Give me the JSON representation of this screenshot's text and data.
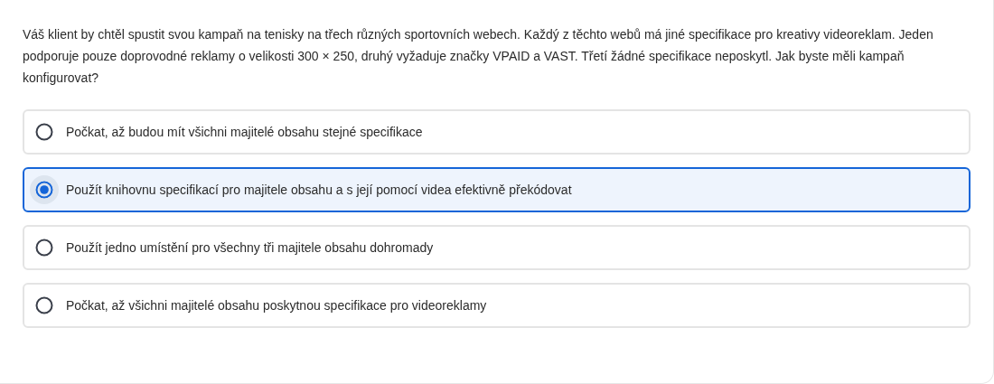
{
  "question": "Váš klient by chtěl spustit svou kampaň na tenisky na třech různých sportovních webech. Každý z těchto webů má jiné specifikace pro kreativy videoreklam. Jeden podporuje pouze doprovodné reklamy o velikosti 300 × 250, druhý vyžaduje značky VPAID a VAST. Třetí žádné specifikace neposkytl. Jak byste měli kampaň konfigurovat?",
  "options": [
    {
      "label": "Počkat, až budou mít všichni majitelé obsahu stejné specifikace",
      "selected": false
    },
    {
      "label": "Použít knihovnu specifikací pro majitele obsahu a s její pomocí videa efektivně překódovat",
      "selected": true
    },
    {
      "label": "Použít jedno umístění pro všechny tři majitele obsahu dohromady",
      "selected": false
    },
    {
      "label": "Počkat, až všichni majitelé obsahu poskytnou specifikace pro videoreklamy",
      "selected": false
    }
  ]
}
